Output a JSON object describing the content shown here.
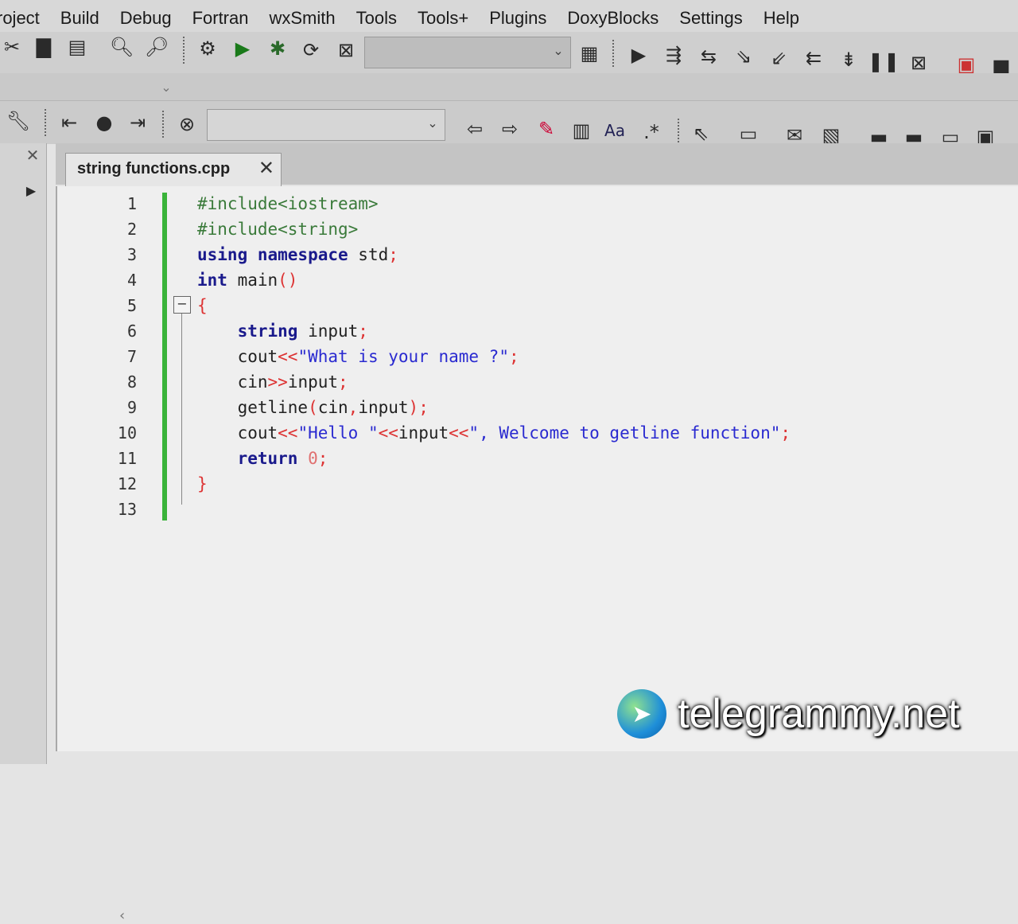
{
  "menu": [
    "roject",
    "Build",
    "Debug",
    "Fortran",
    "wxSmith",
    "Tools",
    "Tools+",
    "Plugins",
    "DoxyBlocks",
    "Settings",
    "Help"
  ],
  "editor": {
    "tab_title": "string functions.cpp",
    "line_numbers": [
      "1",
      "2",
      "3",
      "4",
      "5",
      "6",
      "7",
      "8",
      "9",
      "10",
      "11",
      "12",
      "13"
    ],
    "lines": [
      [
        {
          "t": "#include<iostream>",
          "c": "pp"
        }
      ],
      [
        {
          "t": "#include<string>",
          "c": "pp"
        }
      ],
      [
        {
          "t": "using namespace ",
          "c": "kw"
        },
        {
          "t": "std",
          "c": ""
        },
        {
          "t": ";",
          "c": "op"
        }
      ],
      [
        {
          "t": "int ",
          "c": "kw"
        },
        {
          "t": "main",
          "c": ""
        },
        {
          "t": "()",
          "c": "op"
        }
      ],
      [
        {
          "t": "{",
          "c": "op"
        }
      ],
      [
        {
          "t": "    string ",
          "c": "kw"
        },
        {
          "t": "input",
          "c": ""
        },
        {
          "t": ";",
          "c": "op"
        }
      ],
      [
        {
          "t": "    cout",
          "c": ""
        },
        {
          "t": "<<",
          "c": "op"
        },
        {
          "t": "\"What is your name ?\"",
          "c": "str"
        },
        {
          "t": ";",
          "c": "op"
        }
      ],
      [
        {
          "t": "    cin",
          "c": ""
        },
        {
          "t": ">>",
          "c": "op"
        },
        {
          "t": "input",
          "c": ""
        },
        {
          "t": ";",
          "c": "op"
        }
      ],
      [
        {
          "t": "    getline",
          "c": ""
        },
        {
          "t": "(",
          "c": "op"
        },
        {
          "t": "cin",
          "c": ""
        },
        {
          "t": ",",
          "c": "op"
        },
        {
          "t": "input",
          "c": ""
        },
        {
          "t": ");",
          "c": "op"
        }
      ],
      [
        {
          "t": "    cout",
          "c": ""
        },
        {
          "t": "<<",
          "c": "op"
        },
        {
          "t": "\"Hello \"",
          "c": "str"
        },
        {
          "t": "<<",
          "c": "op"
        },
        {
          "t": "input",
          "c": ""
        },
        {
          "t": "<<",
          "c": "op"
        },
        {
          "t": "\", Welcome to getline function\"",
          "c": "str"
        },
        {
          "t": ";",
          "c": "op"
        }
      ],
      [
        {
          "t": "    return ",
          "c": "kw"
        },
        {
          "t": "0",
          "c": "num"
        },
        {
          "t": ";",
          "c": "op"
        }
      ],
      [
        {
          "t": "}",
          "c": "op"
        }
      ],
      [
        {
          "t": "",
          "c": ""
        }
      ]
    ]
  },
  "watermark": "telegrammy.net",
  "colors": {
    "change_bar": "#39b339",
    "keyword": "#1a1a8c",
    "string": "#2a2ad0",
    "operator": "#d33"
  },
  "icons": [
    "cut-icon",
    "copy-icon",
    "paste-icon",
    "find-icon",
    "replace-icon",
    "build-icon",
    "run-icon",
    "build-run-icon",
    "rebuild-icon",
    "abort-icon",
    "debug-icon",
    "pause-icon",
    "stop-icon"
  ]
}
